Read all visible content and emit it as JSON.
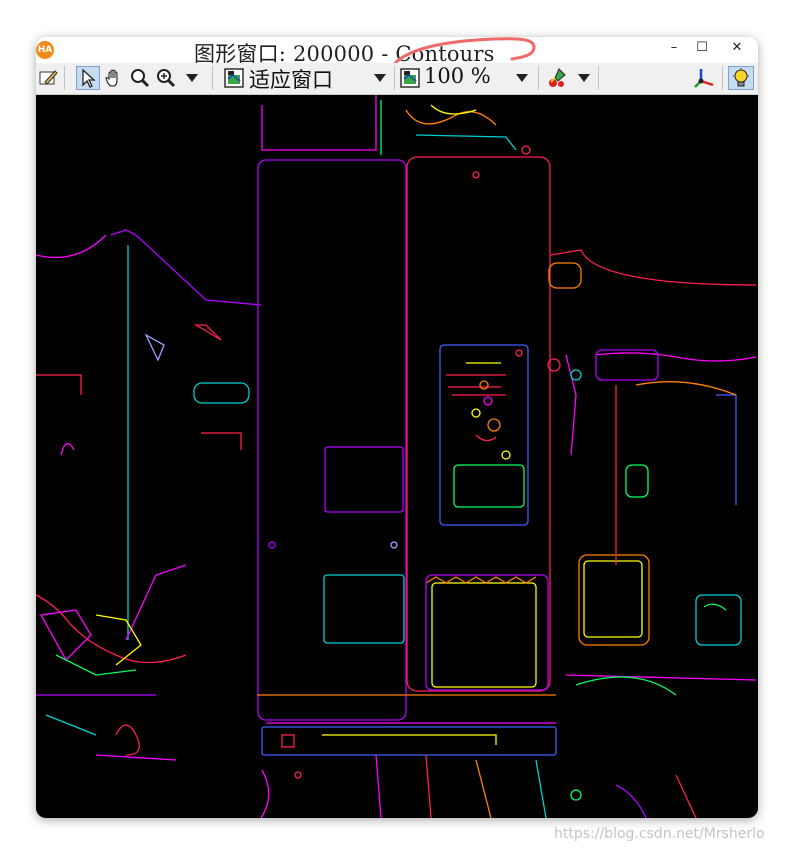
{
  "window": {
    "title": "图形窗口: 200000 - Contours",
    "app_icon_text": "HA",
    "controls": {
      "minimize": "–",
      "maximize": "☐",
      "close": "✕"
    }
  },
  "toolbar": {
    "fit_label": "适应窗口",
    "zoom_label": "100 %",
    "tools": [
      "edit-pen-icon",
      "pointer-icon",
      "hand-pan-icon",
      "magnify-icon",
      "zoom-in-icon",
      "fit-window-icon",
      "zoom-icon",
      "paint-colors-icon",
      "axis-xyz-icon",
      "light-bulb-icon"
    ]
  },
  "canvas": {
    "description_colors": [
      "#ff2050",
      "#00d0d0",
      "#b000ff",
      "#ff8000",
      "#ffff00",
      "#00ff60",
      "#ff00ff",
      "#4060ff",
      "#a0a0ff"
    ]
  },
  "watermark": "https://blog.csdn.net/Mrsherlo"
}
